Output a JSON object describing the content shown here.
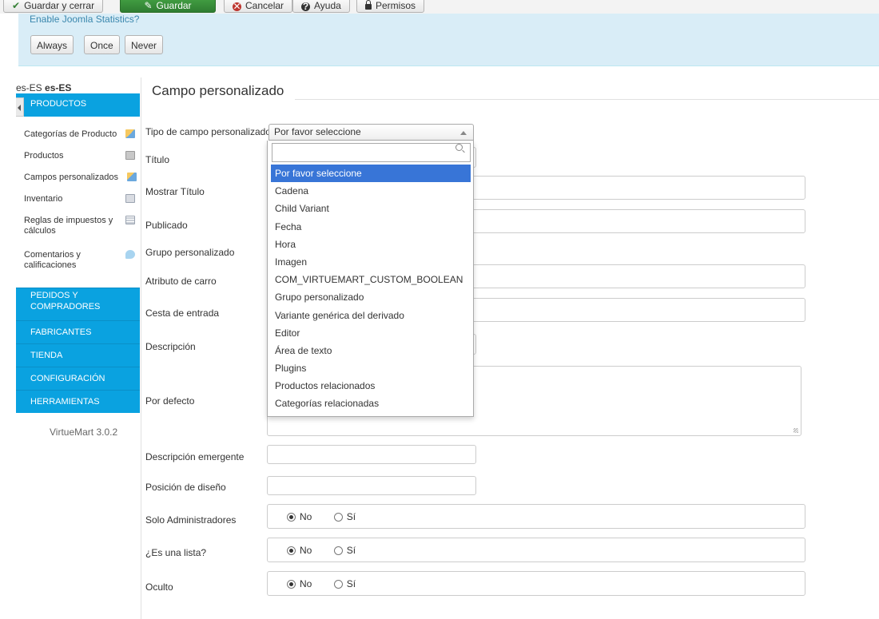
{
  "toolbar": {
    "save_close": "Guardar y cerrar",
    "save": "Guardar",
    "cancel": "Cancelar",
    "help": "Ayuda",
    "permissions": "Permisos"
  },
  "stats": {
    "question": "Enable Joomla Statistics?",
    "always": "Always",
    "once": "Once",
    "never": "Never"
  },
  "sidebar": {
    "lang_plain": "es-ES",
    "lang_bold": "es-ES",
    "header": "PRODUCTOS",
    "items": [
      {
        "label": "Categorías de Producto",
        "icon": "category-icon"
      },
      {
        "label": "Productos",
        "icon": "product-icon"
      },
      {
        "label": "Campos personalizados",
        "icon": "custom-fields-icon"
      },
      {
        "label": "Inventario",
        "icon": "inventory-icon"
      },
      {
        "label": "Reglas de impuestos y cálculos",
        "icon": "tax-rules-icon"
      },
      {
        "label": "Comentarios y calificaciones",
        "icon": "comments-icon"
      }
    ],
    "sections": [
      "PEDIDOS Y COMPRADORES",
      "FABRICANTES",
      "TIENDA",
      "CONFIGURACIÓN",
      "HERRAMIENTAS"
    ],
    "version": "VirtueMart 3.0.2"
  },
  "form": {
    "title": "Campo personalizado",
    "labels": {
      "type": "Tipo de campo personalizado",
      "title": "Título",
      "show_title": "Mostrar Título",
      "published": "Publicado",
      "custom_group": "Grupo personalizado",
      "cart_attribute": "Atributo de carro",
      "cart_input": "Cesta de entrada",
      "description": "Descripción",
      "default": "Por defecto",
      "tooltip": "Descripción emergente",
      "layout_pos": "Posición de diseño",
      "admin_only": "Solo Administradores",
      "is_list": "¿Es una lista?",
      "hidden": "Oculto"
    },
    "radio_no": "No",
    "radio_yes": "Sí"
  },
  "select": {
    "value": "Por favor seleccione",
    "search_value": "",
    "options": [
      "Por favor seleccione",
      "Cadena",
      "Child Variant",
      "Fecha",
      "Hora",
      "Imagen",
      "COM_VIRTUEMART_CUSTOM_BOOLEAN",
      "Grupo personalizado",
      "Variante genérica del derivado",
      "Editor",
      "Área de texto",
      "Plugins",
      "Productos relacionados",
      "Categorías relacionadas"
    ],
    "highlighted_index": 0
  }
}
